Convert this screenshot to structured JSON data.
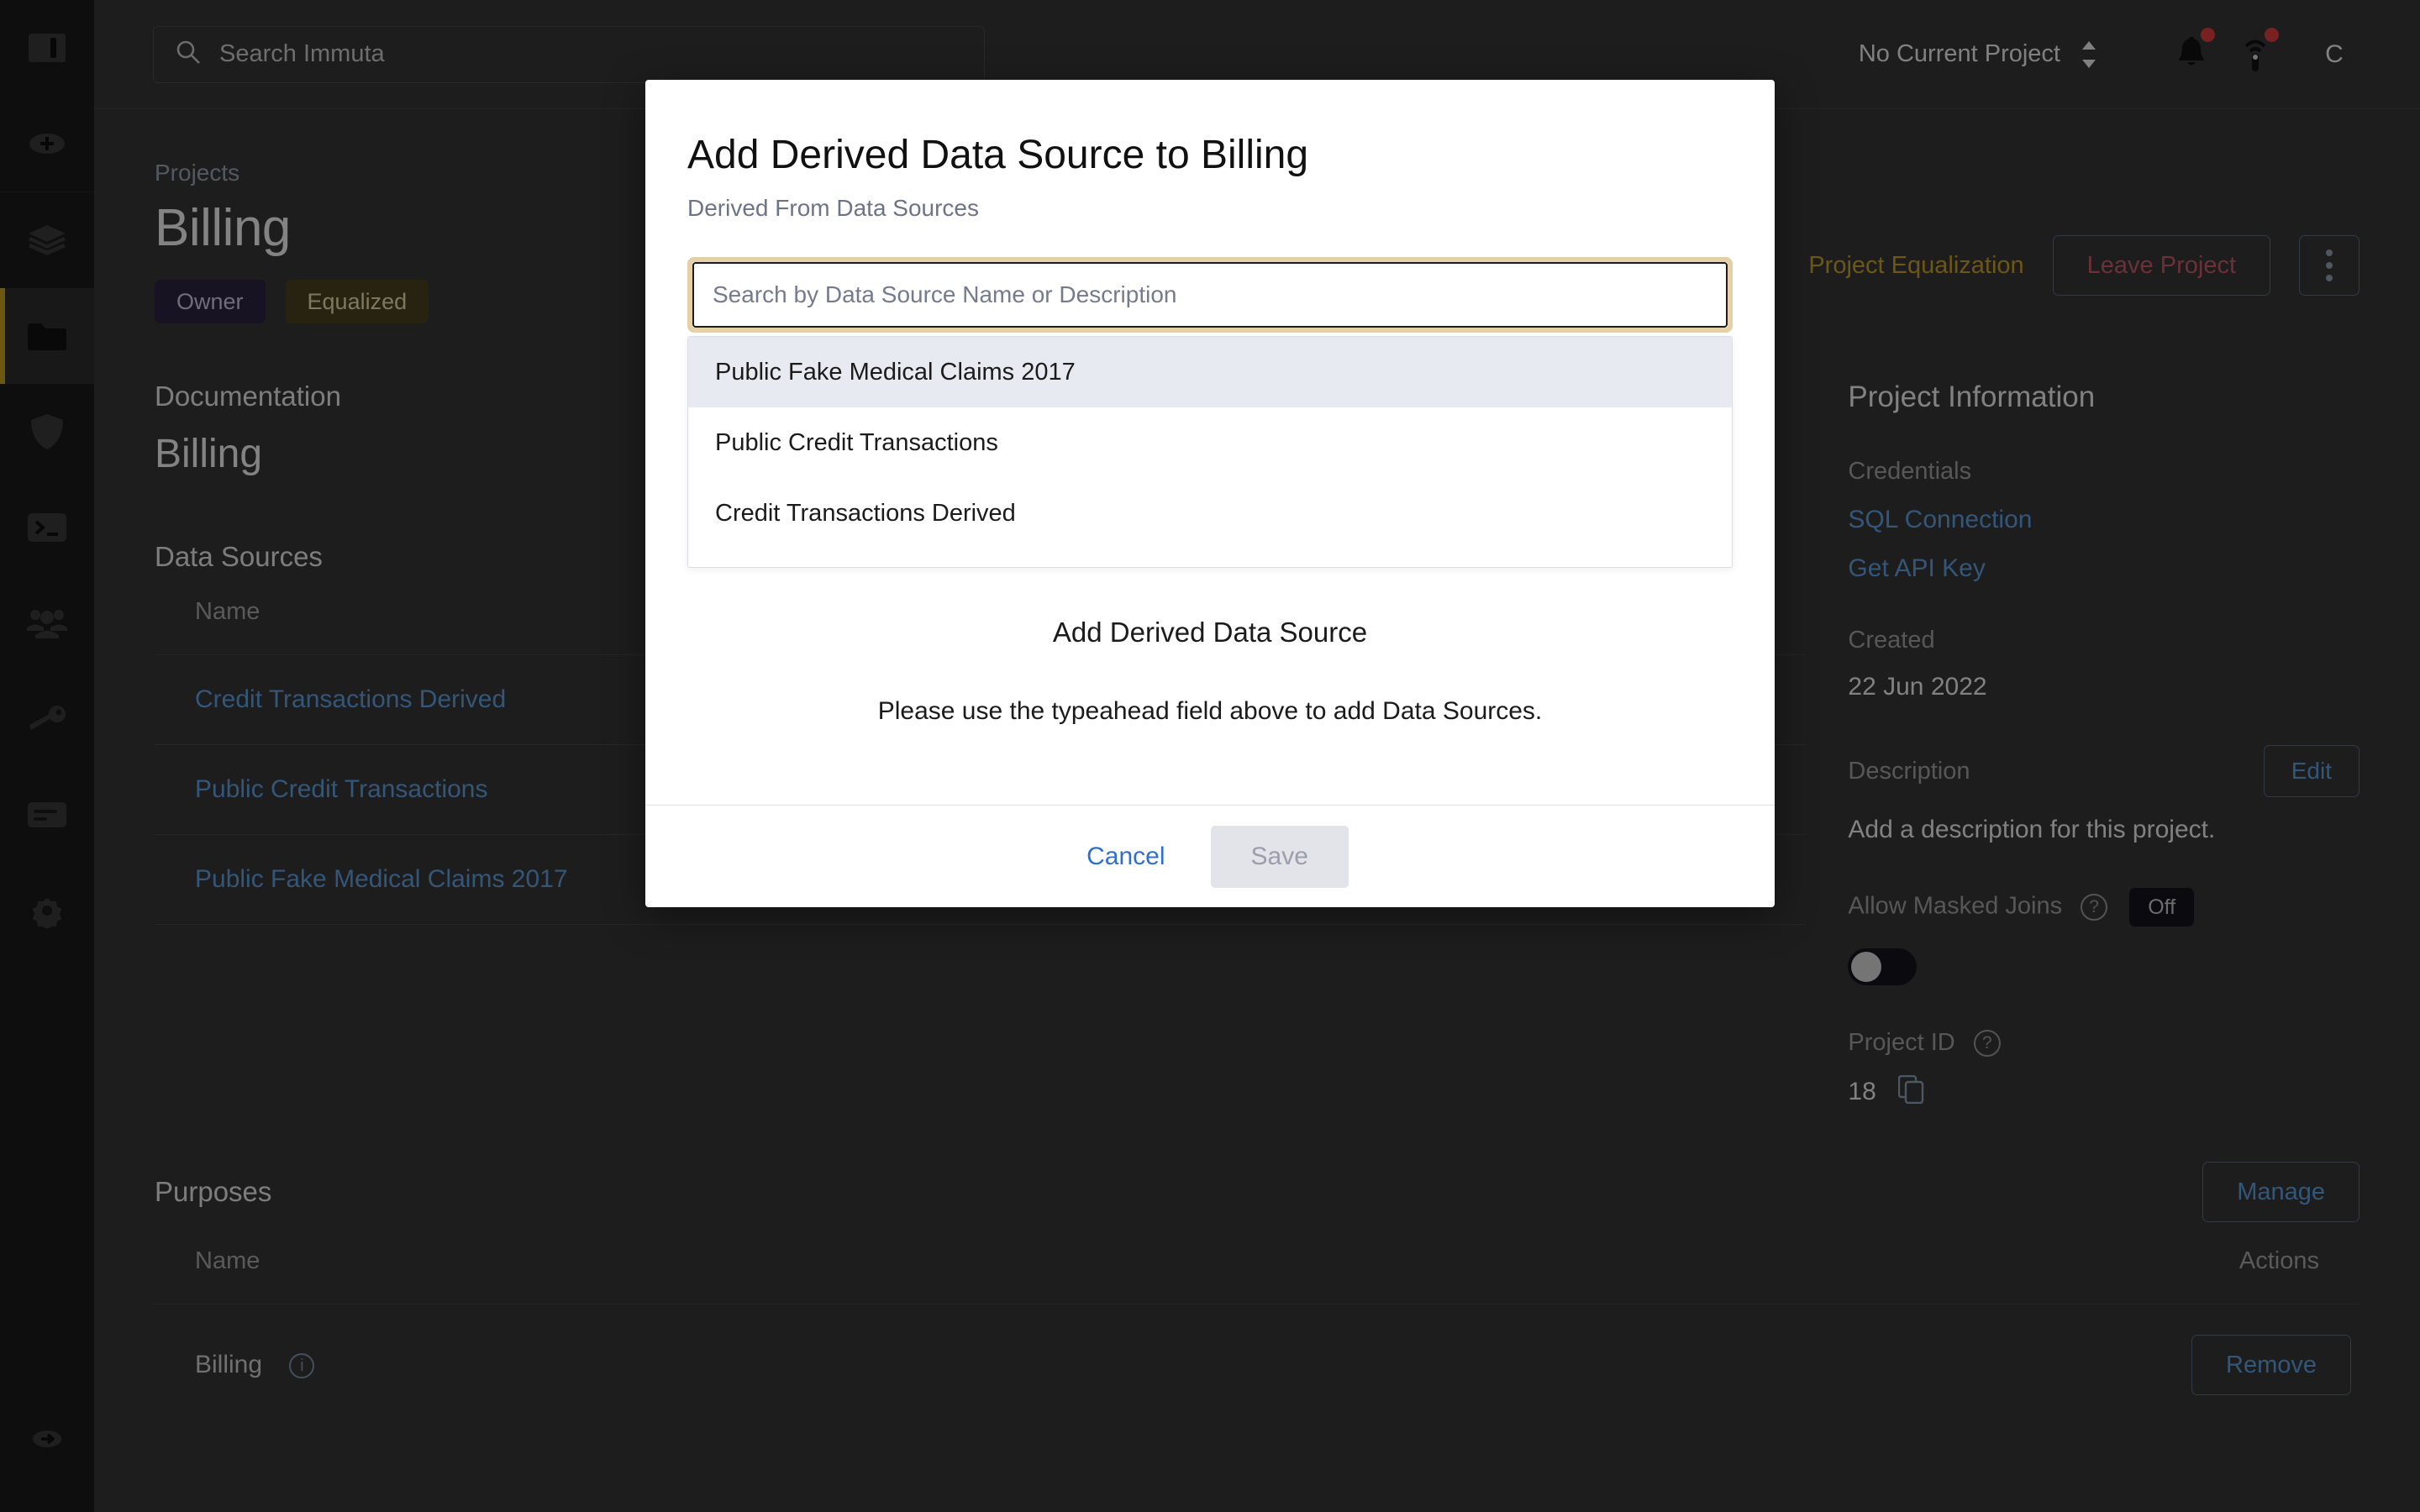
{
  "topbar": {
    "search_placeholder": "Search Immuta",
    "search_icon": "search-icon",
    "current_project": "No Current Project",
    "stepper_icon": "chevron-up-down-icon",
    "bell_icon": "bell-icon",
    "broadcast_icon": "broadcast-icon",
    "avatar_letter": "C"
  },
  "rail": {
    "items": [
      {
        "icon": "panel-toggle-icon",
        "name": "sidebar-toggle",
        "active": false
      },
      {
        "icon": "plus-circle-icon",
        "name": "add-new",
        "active": false
      },
      {
        "icon": "layers-icon",
        "name": "data-sources",
        "active": false
      },
      {
        "icon": "folder-icon",
        "name": "projects",
        "active": true
      },
      {
        "icon": "shield-icon",
        "name": "policies",
        "active": false
      },
      {
        "icon": "terminal-icon",
        "name": "queries",
        "active": false
      },
      {
        "icon": "people-icon",
        "name": "people",
        "active": false
      },
      {
        "icon": "key-icon",
        "name": "identity",
        "active": false
      },
      {
        "icon": "audit-log-icon",
        "name": "audit",
        "active": false
      },
      {
        "icon": "gear-icon",
        "name": "settings",
        "active": false
      }
    ],
    "bottom_icon": "sign-out-icon"
  },
  "project": {
    "breadcrumb": "Projects",
    "title": "Billing",
    "tags": [
      {
        "label": "Owner",
        "kind": "owner"
      },
      {
        "label": "Equalized",
        "kind": "equalized"
      }
    ],
    "equalization_link": "Project Equalization",
    "leave_button": "Leave Project",
    "kebab_icon": "kebab-menu-icon"
  },
  "documentation": {
    "label": "Documentation",
    "body": "Billing"
  },
  "data_sources": {
    "title": "Data Sources",
    "columns": [
      "Name"
    ],
    "rows": [
      {
        "name": "Credit Transactions Derived"
      },
      {
        "name": "Public Credit Transactions"
      },
      {
        "name": "Public Fake Medical Claims 2017"
      }
    ]
  },
  "purposes": {
    "title": "Purposes",
    "manage_button": "Manage",
    "columns": [
      "Name",
      "Actions"
    ],
    "rows": [
      {
        "name": "Billing",
        "info_icon": "info-icon",
        "action": "Remove"
      }
    ]
  },
  "project_info": {
    "title": "Project Information",
    "credentials_label": "Credentials",
    "sql_connection": "SQL Connection",
    "get_api_key": "Get API Key",
    "created_label": "Created",
    "created_value": "22 Jun 2022",
    "description_label": "Description",
    "description_edit": "Edit",
    "description_value": "Add a description for this project.",
    "masked_joins_label": "Allow Masked Joins",
    "masked_joins_help_icon": "question-circle-icon",
    "masked_joins_state": "Off",
    "project_id_label": "Project ID",
    "project_id_help_icon": "question-circle-icon",
    "project_id_value": "18",
    "copy_icon": "copy-icon"
  },
  "modal": {
    "title": "Add Derived Data Source to Billing",
    "subtitle": "Derived From Data Sources",
    "search_placeholder": "Search by Data Source Name or Description",
    "suggestions": [
      {
        "label": "Public Fake Medical Claims 2017",
        "highlighted": true
      },
      {
        "label": "Public Credit Transactions",
        "highlighted": false
      },
      {
        "label": "Credit Transactions Derived",
        "highlighted": false
      }
    ],
    "empty_title": "Add Derived Data Source",
    "empty_message": "Please use the typeahead field above to add Data Sources.",
    "cancel_label": "Cancel",
    "save_label": "Save"
  },
  "colors": {
    "accent_gold": "#c9a227",
    "link_blue": "#5e9fe0",
    "danger_red": "#c8596a",
    "focus_ring": "#e7cfa6",
    "badge_red": "#e03c3c"
  }
}
